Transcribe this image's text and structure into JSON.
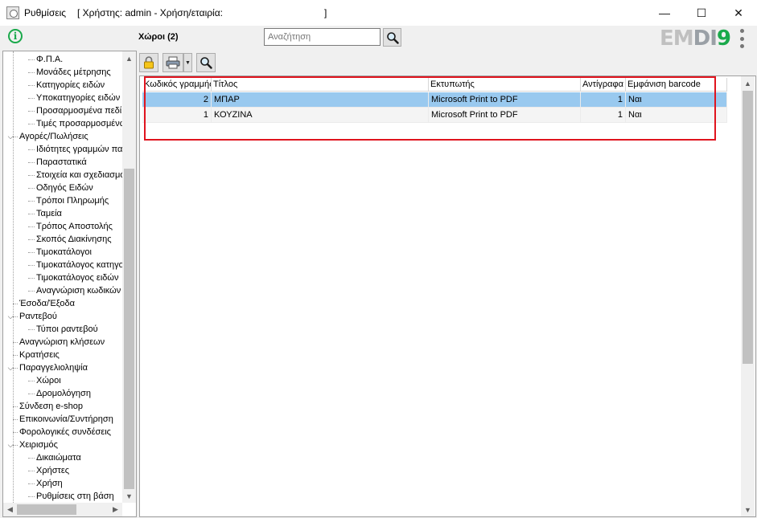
{
  "window": {
    "title": "Ρυθμίσεις",
    "user_info": "[ Χρήστης: admin - Χρήση/εταιρία:",
    "user_info_end": "]",
    "minimize_symbol": "—",
    "maximize_symbol": "☐",
    "close_symbol": "✕"
  },
  "header": {
    "section_title": "Χώροι (2)",
    "search_placeholder": "Αναζήτηση",
    "logo": {
      "part1": "EM",
      "part2": "DI",
      "part3": "9"
    },
    "info_symbol": "i"
  },
  "tree": {
    "items": [
      {
        "label": "Φ.Π.Α.",
        "level": 2
      },
      {
        "label": "Μονάδες μέτρησης",
        "level": 2
      },
      {
        "label": "Κατηγορίες ειδών",
        "level": 2
      },
      {
        "label": "Υποκατηγορίες ειδών",
        "level": 2
      },
      {
        "label": "Προσαρμοσμένα πεδί",
        "level": 2
      },
      {
        "label": "Τιμές προσαρμοσμένω",
        "level": 2
      },
      {
        "label": "Αγορές/Πωλήσεις",
        "level": 1,
        "expanded": true
      },
      {
        "label": "Ιδιότητες γραμμών παρ",
        "level": 2
      },
      {
        "label": "Παραστατικά",
        "level": 2
      },
      {
        "label": "Στοιχεία και σχεδιασμό",
        "level": 2
      },
      {
        "label": "Οδηγός Ειδών",
        "level": 2
      },
      {
        "label": "Τρόποι Πληρωμής",
        "level": 2
      },
      {
        "label": "Ταμεία",
        "level": 2
      },
      {
        "label": "Τρόπος Αποστολής",
        "level": 2
      },
      {
        "label": "Σκοπός Διακίνησης",
        "level": 2
      },
      {
        "label": "Τιμοκατάλογοι",
        "level": 2
      },
      {
        "label": "Τιμοκατάλογος κατηγο",
        "level": 2
      },
      {
        "label": "Τιμοκατάλογος ειδών",
        "level": 2
      },
      {
        "label": "Αναγνώριση κωδικών",
        "level": 2
      },
      {
        "label": "Έσοδα/Έξοδα",
        "level": 1
      },
      {
        "label": "Ραντεβού",
        "level": 1,
        "expanded": true
      },
      {
        "label": "Τύποι ραντεβού",
        "level": 2
      },
      {
        "label": "Αναγνώριση κλήσεων",
        "level": 1
      },
      {
        "label": "Κρατήσεις",
        "level": 1
      },
      {
        "label": "Παραγγελιοληψία",
        "level": 1,
        "expanded": true
      },
      {
        "label": "Χώροι",
        "level": 2
      },
      {
        "label": "Δρομολόγηση",
        "level": 2
      },
      {
        "label": "Σύνδεση e-shop",
        "level": 1
      },
      {
        "label": "Επικοινωνία/Συντήρηση",
        "level": 1
      },
      {
        "label": "Φορολογικές συνδέσεις",
        "level": 1
      },
      {
        "label": "Χειρισμός",
        "level": 1,
        "expanded": true
      },
      {
        "label": "Δικαιώματα",
        "level": 2
      },
      {
        "label": "Χρήστες",
        "level": 2
      },
      {
        "label": "Χρήση",
        "level": 2
      },
      {
        "label": "Ρυθμίσεις στη βάση",
        "level": 2
      }
    ]
  },
  "grid": {
    "columns": [
      "Κωδικός γραμμής",
      "Τίτλος",
      "Εκτυπωτής",
      "Αντίγραφα",
      "Εμφάνιση barcode"
    ],
    "rows": [
      {
        "code": "2",
        "title": "ΜΠΑΡ",
        "printer": "Microsoft Print to PDF",
        "copies": "1",
        "barcode": "Ναι",
        "selected": true
      },
      {
        "code": "1",
        "title": "ΚΟΥΖΙΝΑ",
        "printer": "Microsoft Print to PDF",
        "copies": "1",
        "barcode": "Ναι",
        "selected": false
      }
    ]
  },
  "colors": {
    "accent_green": "#1aa94b",
    "selection": "#99c9ef",
    "highlight_border": "#e0141e"
  },
  "icons": {
    "lock": "lock-icon",
    "print": "printer-icon",
    "search": "magnifier-icon",
    "info": "info-icon"
  }
}
